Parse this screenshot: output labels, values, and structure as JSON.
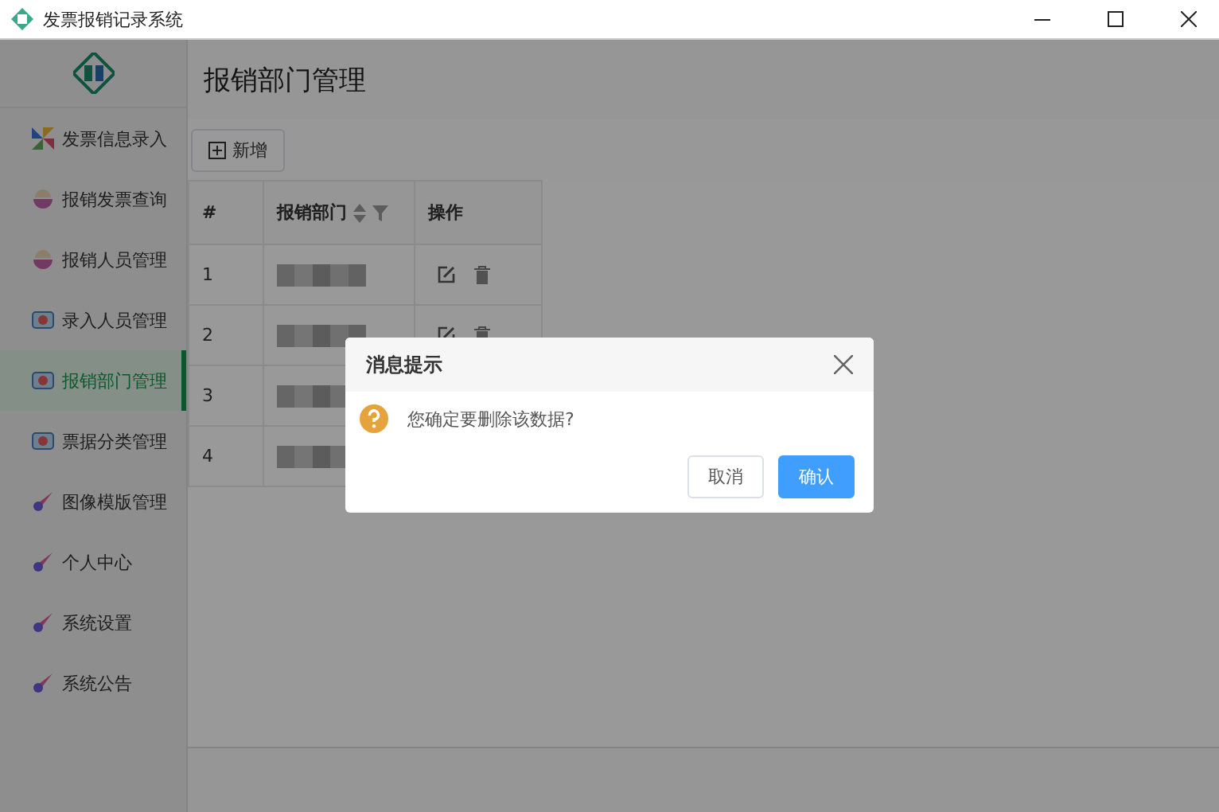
{
  "window": {
    "title": "发票报销记录系统"
  },
  "sidebar": {
    "items": [
      {
        "label": "发票信息录入",
        "kind": "pinwheel",
        "selected": false
      },
      {
        "label": "报销发票查询",
        "kind": "bowl",
        "selected": false
      },
      {
        "label": "报销人员管理",
        "kind": "bowl",
        "selected": false
      },
      {
        "label": "录入人员管理",
        "kind": "camera",
        "selected": false
      },
      {
        "label": "报销部门管理",
        "kind": "camera",
        "selected": true
      },
      {
        "label": "票据分类管理",
        "kind": "camera",
        "selected": false
      },
      {
        "label": "图像模版管理",
        "kind": "comet",
        "selected": false
      },
      {
        "label": "个人中心",
        "kind": "comet",
        "selected": false
      },
      {
        "label": "系统设置",
        "kind": "comet",
        "selected": false
      },
      {
        "label": "系统公告",
        "kind": "comet",
        "selected": false
      }
    ]
  },
  "page": {
    "title": "报销部门管理",
    "add_button": "新增"
  },
  "table": {
    "columns": [
      "#",
      "报销部门",
      "操作"
    ],
    "rows": [
      {
        "index": "1",
        "actions": [
          {
            "kind": "edit"
          },
          {
            "kind": "delete"
          }
        ]
      },
      {
        "index": "2",
        "actions": [
          {
            "kind": "edit"
          },
          {
            "kind": "delete"
          }
        ]
      },
      {
        "index": "3"
      },
      {
        "index": "4"
      }
    ]
  },
  "dialog": {
    "title": "消息提示",
    "message": "您确定要删除该数据?",
    "cancel": "取消",
    "confirm": "确认"
  }
}
